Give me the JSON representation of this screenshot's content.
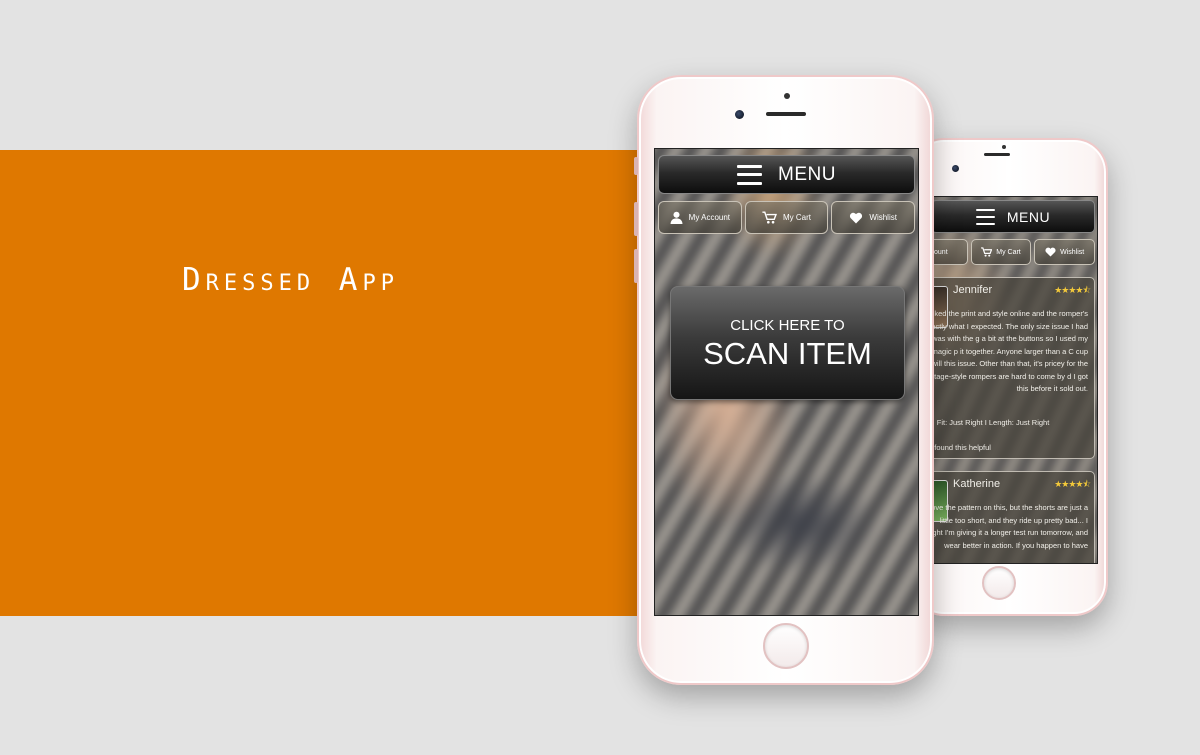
{
  "hero": {
    "title": "Dressed App"
  },
  "colors": {
    "accent": "#df7800",
    "background": "#e3e3e3"
  },
  "front_screen": {
    "menu_label": "MENU",
    "nav": [
      {
        "label": "My Account",
        "icon": "user-icon"
      },
      {
        "label": "My Cart",
        "icon": "cart-icon"
      },
      {
        "label": "Wishlist",
        "icon": "heart-icon"
      }
    ],
    "scan_button": {
      "line1": "CLICK HERE TO",
      "line2": "SCAN ITEM"
    }
  },
  "back_screen": {
    "menu_label": "MENU",
    "nav": [
      {
        "label": "ccount",
        "icon": "user-icon"
      },
      {
        "label": "My Cart",
        "icon": "cart-icon"
      },
      {
        "label": "Wishlist",
        "icon": "heart-icon"
      }
    ],
    "reviews": [
      {
        "name": "Jennifer",
        "rating_stars": 4.5,
        "stars_text": "★★★★⯪",
        "text": "I liked the print and style online and the romper's exactly what I expected. The only size issue I had was with the g a bit at the buttons so I used my magic p it together. Anyone larger than a C cup will this issue. Other than that, it's pricey for the vintage-style rompers are hard to come by d I got this before it sold out.",
        "fit_line": "ood I Fit: Just Right I Length: Just Right",
        "helpful": "ople found this helpful"
      },
      {
        "name": "Katherine",
        "rating_stars": 4.5,
        "stars_text": "★★★★⯪",
        "text": "I love the pattern on this, but the shorts are just a little too short, and they ride up pretty bad... I might I'm giving it a longer test run tomorrow, and wear better in action. If you happen to have"
      }
    ]
  }
}
